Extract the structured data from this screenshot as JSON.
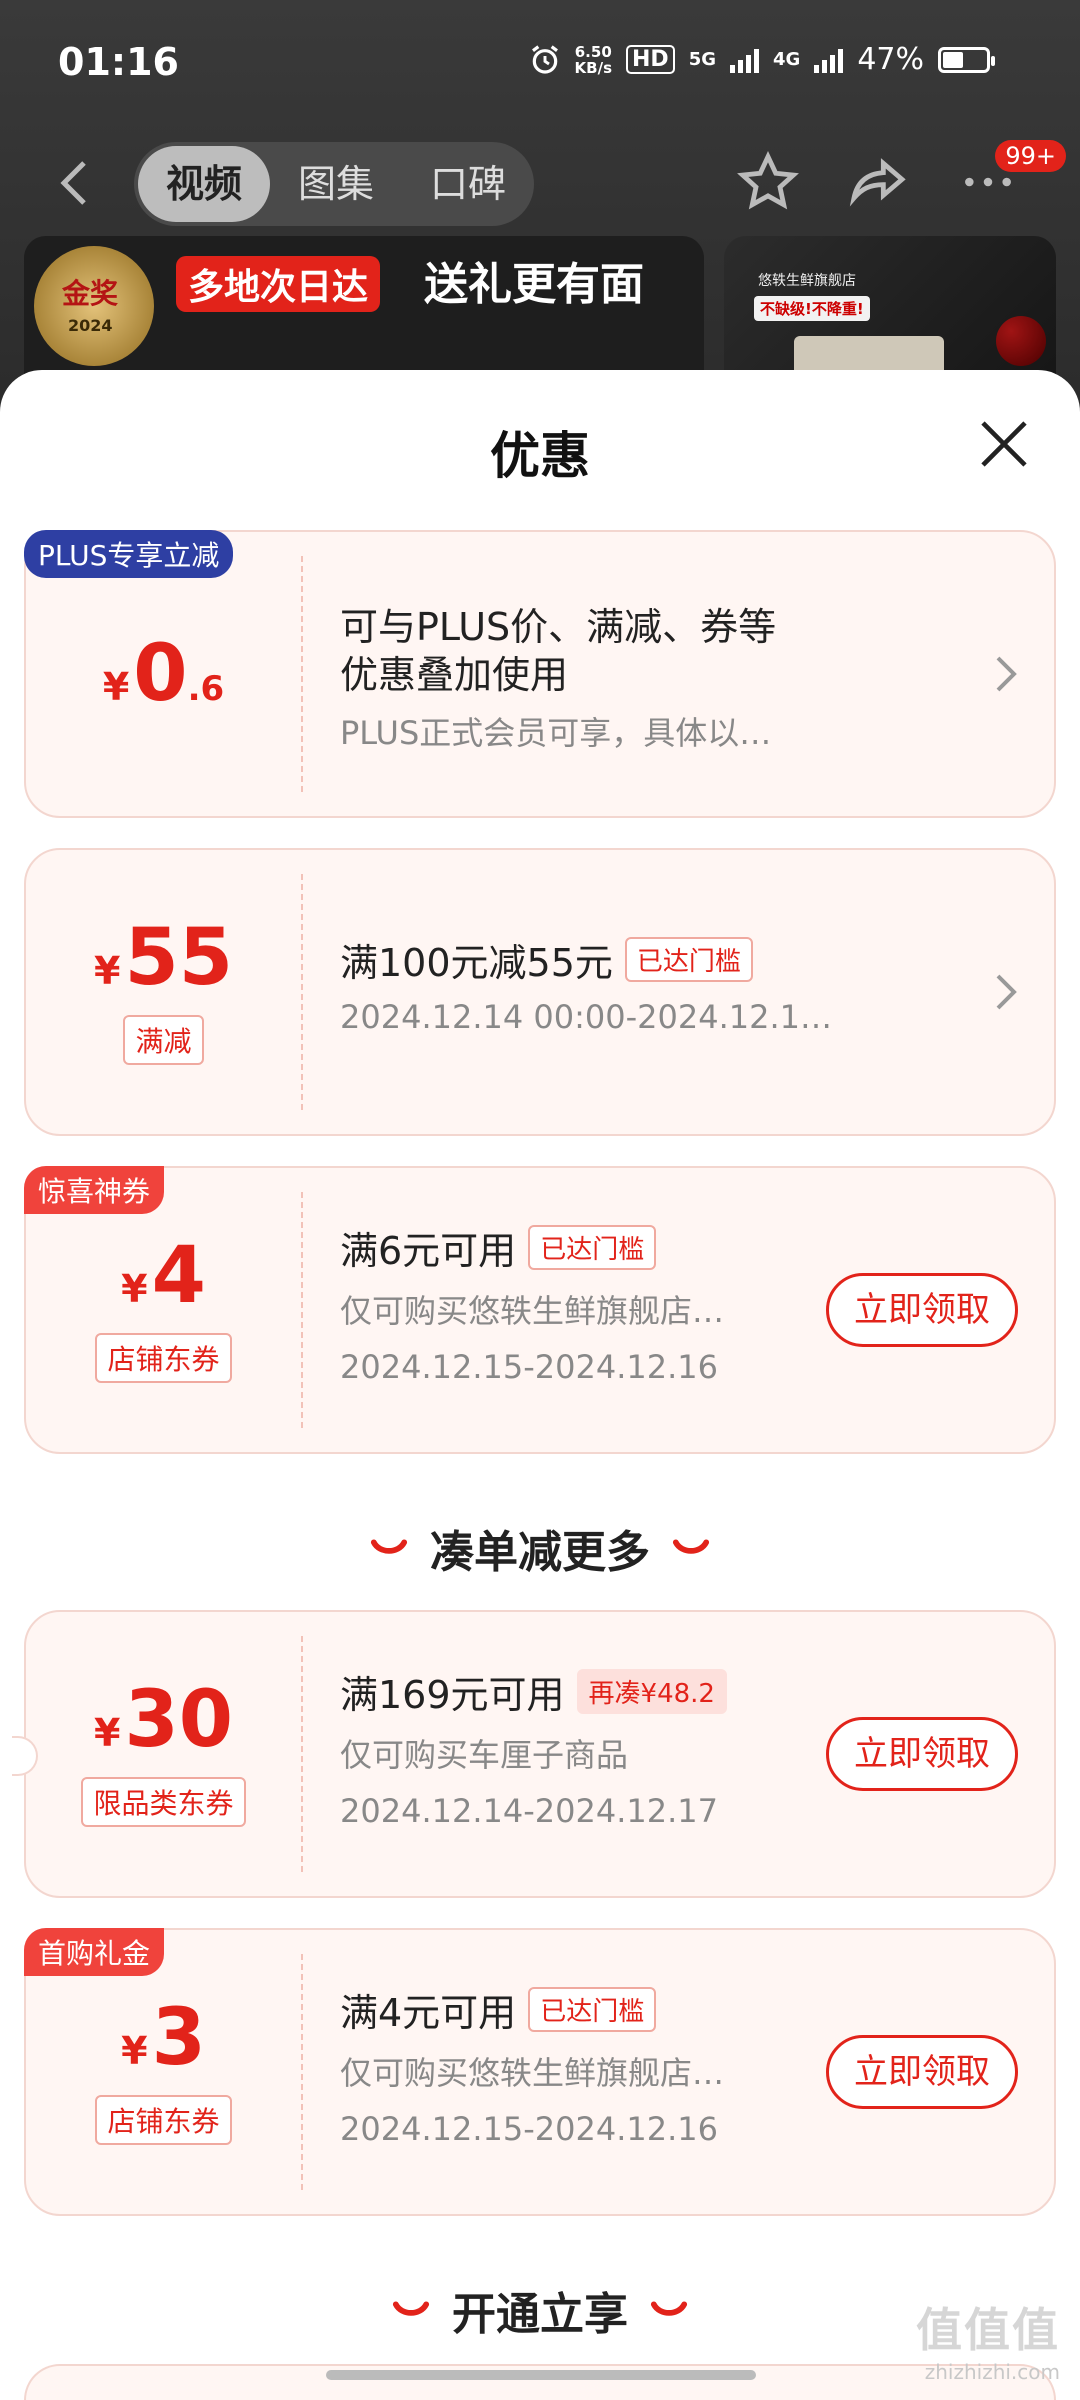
{
  "status_bar": {
    "time": "01:16",
    "net_speed_value": "6.50",
    "net_speed_unit": "KB/s",
    "hd_label": "HD",
    "net_5g": "5G",
    "net_4g": "4G",
    "battery_percent": "47%",
    "battery_level": 0.47
  },
  "nav": {
    "tabs": [
      {
        "label": "视频",
        "active": true
      },
      {
        "label": "图集",
        "active": false
      },
      {
        "label": "口碑",
        "active": false
      }
    ],
    "more_badge": "99+"
  },
  "banner": {
    "award_title": "金奖",
    "award_year": "2024",
    "tag": "多地次日达",
    "slogan": "送礼更有面",
    "side_store": "悠轶生鲜旗舰店",
    "side_slogan": "不缺级!不降重!"
  },
  "sheet": {
    "title": "优惠",
    "coupons_top": [
      {
        "corner": "PLUS专享立减",
        "currency": "¥",
        "amount_int": "0",
        "amount_dec": ".6",
        "tag": "",
        "title_line1": "可与PLUS价、满减、券等",
        "title_line2": "优惠叠加使用",
        "desc": "PLUS正式会员可享，具体以…"
      },
      {
        "corner": "",
        "currency": "¥",
        "amount_int": "55",
        "tag": "满减",
        "title": "满100元减55元",
        "pill": "已达门槛",
        "desc": "2024.12.14 00:00-2024.12.1…"
      },
      {
        "corner": "惊喜神券",
        "currency": "¥",
        "amount_int": "4",
        "tag": "店铺东券",
        "title": "满6元可用",
        "pill": "已达门槛",
        "desc": "仅可购买悠轶生鲜旗舰店…",
        "date": "2024.12.15-2024.12.16",
        "button": "立即领取"
      }
    ],
    "section_more": "凑单减更多",
    "coupons_more": [
      {
        "currency": "¥",
        "amount_int": "30",
        "tag": "限品类东券",
        "title": "满169元可用",
        "pill": "再凑¥48.2",
        "desc": "仅可购买车厘子商品",
        "date": "2024.12.14-2024.12.17",
        "button": "立即领取"
      },
      {
        "corner": "首购礼金",
        "currency": "¥",
        "amount_int": "3",
        "tag": "店铺东券",
        "title": "满4元可用",
        "pill": "已达门槛",
        "desc": "仅可购买悠轶生鲜旗舰店…",
        "date": "2024.12.15-2024.12.16",
        "button": "立即领取"
      }
    ],
    "section_open": "开通立享"
  },
  "watermark": {
    "logo": "值值值",
    "site": "zhizhizhi.com"
  },
  "colors": {
    "accent_red": "#e2231a",
    "plus_blue": "#2e3fa3",
    "coupon_bg": "#fff6f3"
  }
}
